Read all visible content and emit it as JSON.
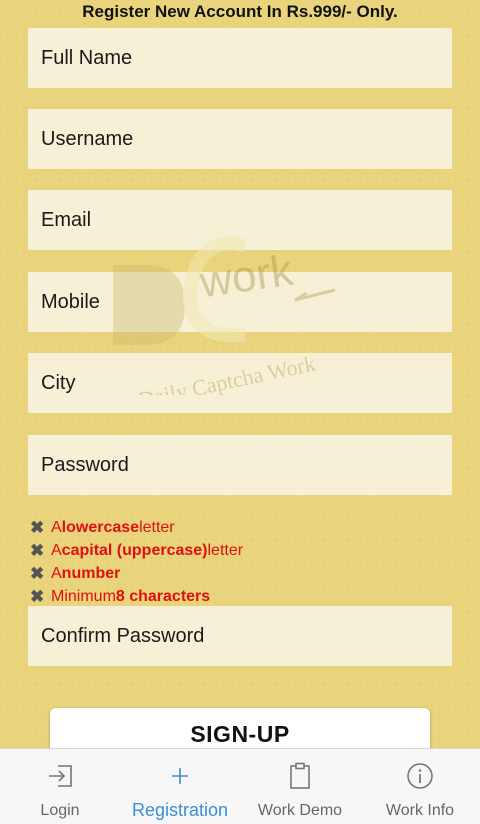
{
  "header": {
    "title": "Register New Account In Rs.999/- Only."
  },
  "form": {
    "full_name": {
      "placeholder": "Full Name"
    },
    "username": {
      "placeholder": "Username"
    },
    "email": {
      "placeholder": "Email"
    },
    "mobile": {
      "placeholder": "Mobile"
    },
    "city": {
      "placeholder": "City"
    },
    "password": {
      "placeholder": "Password"
    },
    "confirm_password": {
      "placeholder": "Confirm Password"
    }
  },
  "watermark": {
    "logo_text": "DC",
    "word": "work",
    "tagline": "Daily Captcha Work"
  },
  "password_rules": [
    {
      "pre": "A ",
      "bold": "lowercase",
      "post": " letter"
    },
    {
      "pre": "A ",
      "bold": "capital (uppercase)",
      "post": " letter"
    },
    {
      "pre": "A ",
      "bold": "number",
      "post": ""
    },
    {
      "pre": "Minimum ",
      "bold": "8 characters",
      "post": ""
    }
  ],
  "rule_mark": "✖",
  "signup_button": {
    "label": "SIGN-UP"
  },
  "tabbar": {
    "tabs": [
      {
        "label": "Login",
        "icon": "login-icon",
        "active": false
      },
      {
        "label": "Registration",
        "icon": "plus-icon",
        "active": true
      },
      {
        "label": "Work Demo",
        "icon": "clipboard-icon",
        "active": false
      },
      {
        "label": "Work Info",
        "icon": "info-icon",
        "active": false
      }
    ]
  },
  "colors": {
    "background": "#e9d47c",
    "field": "#f6f0d6",
    "error": "#e01010",
    "active_tab": "#3a8fd6"
  }
}
